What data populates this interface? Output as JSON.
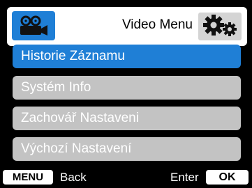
{
  "header": {
    "mode_icon": "video-camera-icon",
    "title": "Video Menu",
    "settings_icon": "gears-icon"
  },
  "menu": {
    "selected_index": 0,
    "items": [
      {
        "label": "Historie Záznamu"
      },
      {
        "label": "Systém Info"
      },
      {
        "label": "Zachovář Nastaveni"
      },
      {
        "label": "Výchozí Nastavení"
      }
    ]
  },
  "footer": {
    "menu_key": "MENU",
    "back_label": "Back",
    "enter_label": "Enter",
    "ok_key": "OK"
  },
  "colors": {
    "accent": "#1f7fd6",
    "item_inactive": "#c3c3c3",
    "background": "#000000"
  }
}
